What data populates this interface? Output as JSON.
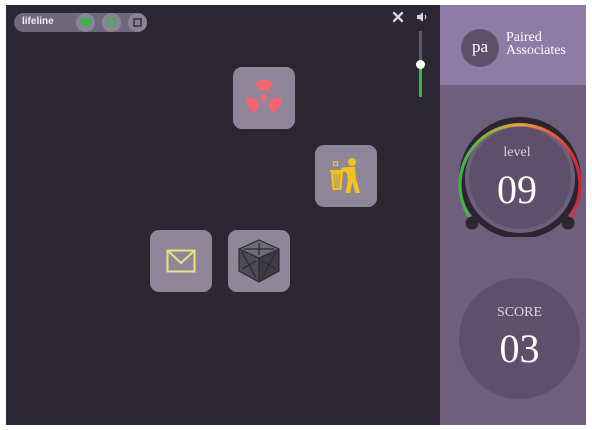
{
  "lifeline": {
    "label": "lifeline",
    "buttons": [
      {
        "name": "heart-icon",
        "color": "#39b54a"
      },
      {
        "name": "square-icon-green",
        "color": "#39b54a"
      },
      {
        "name": "square-icon-dark",
        "color": "#3a3541"
      }
    ]
  },
  "controls": {
    "close_icon": "close-icon",
    "speaker_icon": "speaker-icon",
    "volume_level": 0.5
  },
  "tiles": [
    {
      "name": "radiation-icon",
      "color": "#f2676f"
    },
    {
      "name": "trash-icon",
      "color": "#f4c21b"
    },
    {
      "name": "mail-icon",
      "color": "#e8e27a"
    },
    {
      "name": "crate-icon",
      "color": "#5f5b66"
    }
  ],
  "sidebar": {
    "logo_badge": "pa",
    "logo_line1": "Paired",
    "logo_line2": "Associates",
    "level_label": "level",
    "level_value": "09",
    "score_label": "SCORE",
    "score_value": "03"
  },
  "colors": {
    "game_bg": "#2b2833",
    "tile_bg": "#8f8699",
    "panel_bg": "#6e5f7c",
    "logo_band": "#8f7ca4",
    "accent_green": "#39b54a"
  }
}
